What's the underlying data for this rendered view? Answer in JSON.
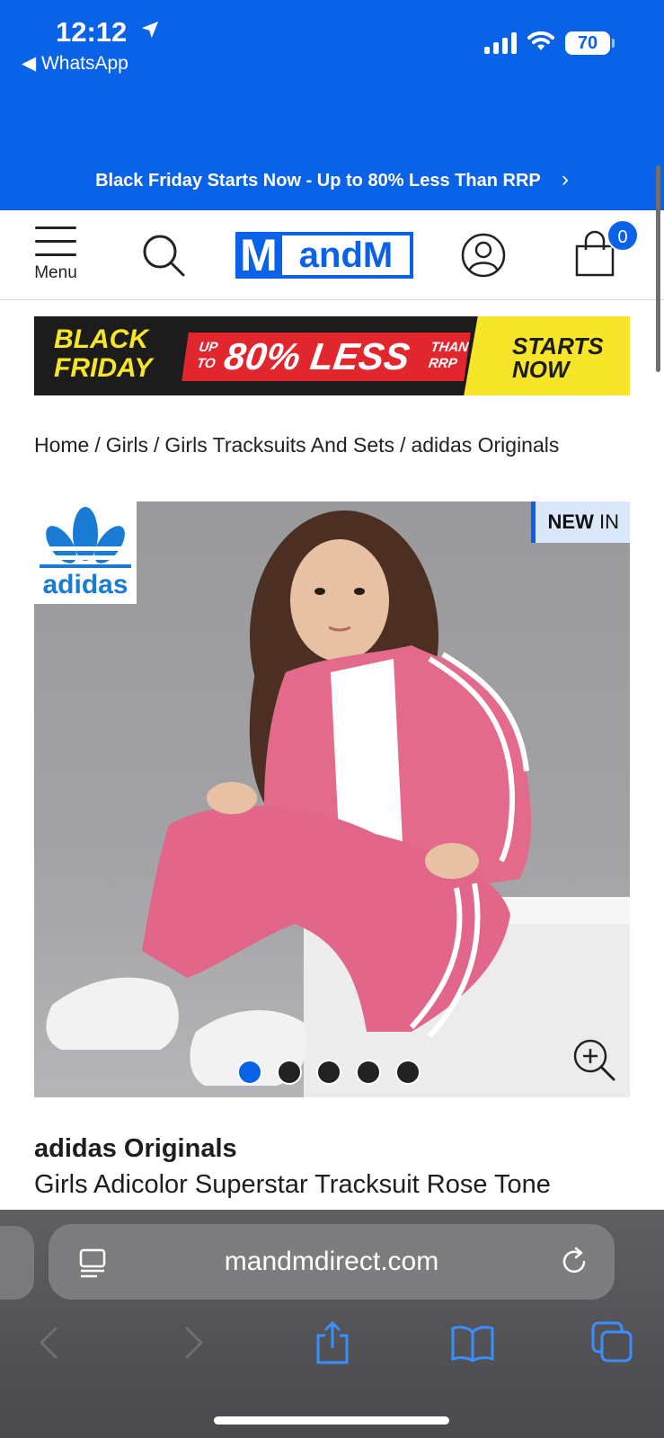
{
  "status_bar": {
    "time": "12:12",
    "back_app": "◀ WhatsApp",
    "battery": "70"
  },
  "promo_bar": {
    "text": "Black Friday Starts Now - Up to 80% Less Than RRP",
    "chevron": "›"
  },
  "header": {
    "menu_label": "Menu",
    "logo_m": "M",
    "logo_rest": "andM",
    "cart_count": "0"
  },
  "banner": {
    "left_line1": "BLACK",
    "left_line2": "FRIDAY",
    "up_to_1": "UP",
    "up_to_2": "TO",
    "big": "80% LESS",
    "than_1": "THAN",
    "than_2": "RRP",
    "right_line1": "STARTS",
    "right_line2": "NOW"
  },
  "breadcrumb": {
    "items": [
      "Home",
      "Girls",
      "Girls Tracksuits And Sets",
      "adidas Originals"
    ],
    "separator": "/"
  },
  "product": {
    "brand_badge": "adidas",
    "new_in_bold": "NEW",
    "new_in_rest": " IN",
    "brand": "adidas Originals",
    "title": "Girls Adicolor Superstar Tracksuit Rose Tone",
    "image_count": 5,
    "active_image_index": 0
  },
  "browser": {
    "url": "mandmdirect.com"
  },
  "colors": {
    "brand_blue": "#0a62e8",
    "black_friday_yellow": "#f7e529",
    "black_friday_red": "#e2262e",
    "tracksuit_pink": "#e36a8a"
  },
  "icons": [
    "location-arrow-icon",
    "signal-icon",
    "wifi-icon",
    "battery-icon",
    "hamburger-icon",
    "search-icon",
    "user-icon",
    "bag-icon",
    "adidas-trefoil-icon",
    "zoom-in-icon",
    "reader-icon",
    "reload-icon",
    "back-icon",
    "forward-icon",
    "share-icon",
    "bookmarks-icon",
    "tabs-icon"
  ]
}
